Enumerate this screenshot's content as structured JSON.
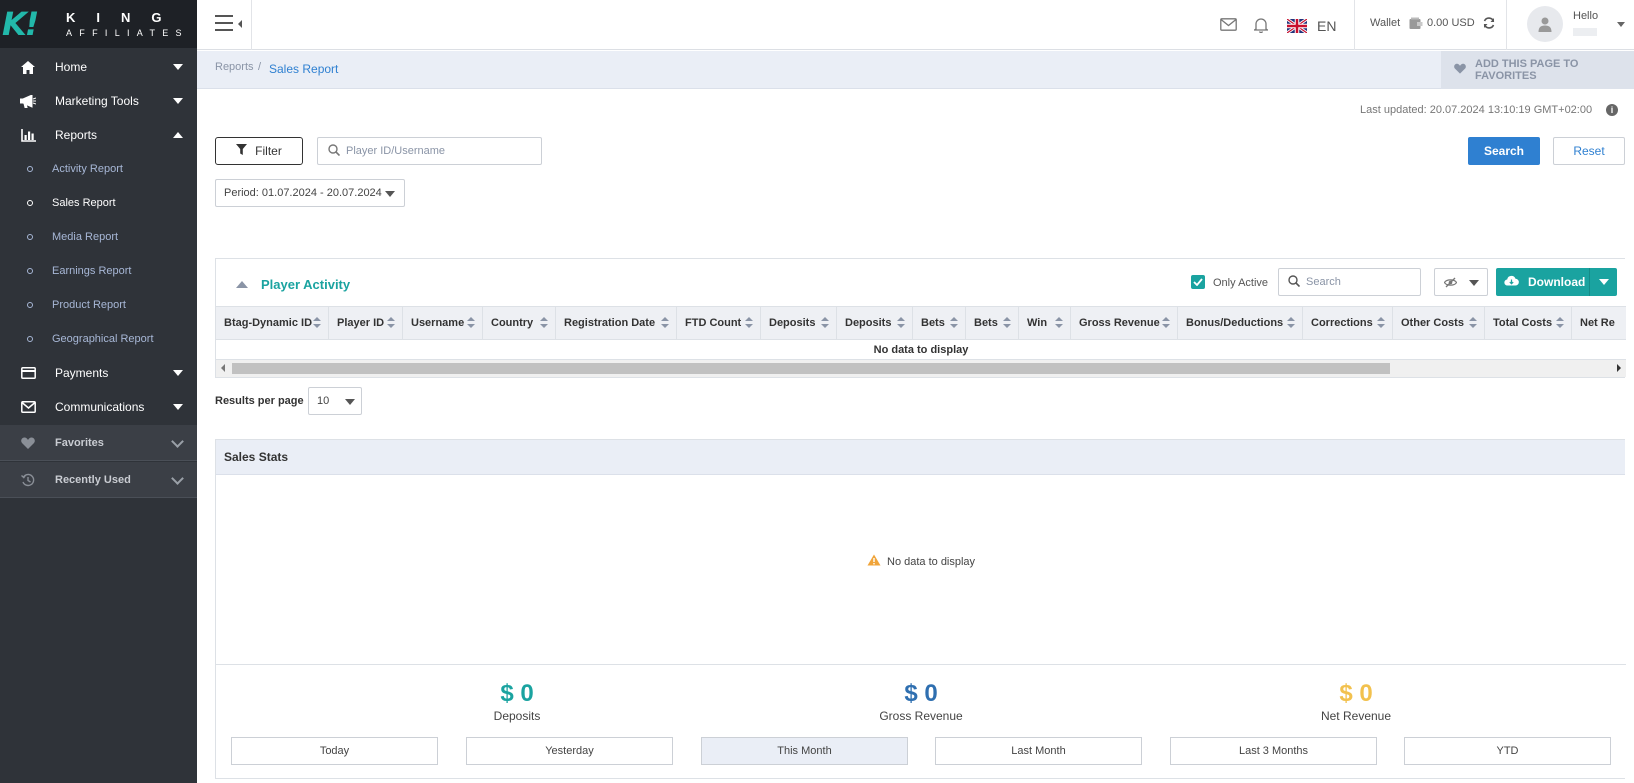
{
  "brand": {
    "logo_mark": "K!",
    "line1": "KING",
    "line2": "AFFILIATES"
  },
  "sidebar": {
    "items": [
      {
        "label": "Home",
        "icon": "home-icon"
      },
      {
        "label": "Marketing Tools",
        "icon": "megaphone-icon"
      },
      {
        "label": "Reports",
        "icon": "bar-chart-icon"
      },
      {
        "label": "Payments",
        "icon": "credit-card-icon"
      },
      {
        "label": "Communications",
        "icon": "envelope-icon"
      }
    ],
    "reports_sub": [
      "Activity Report",
      "Sales Report",
      "Media Report",
      "Earnings Report",
      "Product Report",
      "Geographical Report"
    ],
    "favorites_label": "Favorites",
    "recent_label": "Recently Used"
  },
  "topbar": {
    "language": "EN",
    "wallet_label": "Wallet",
    "wallet_value": "0.00 USD",
    "hello": "Hello"
  },
  "breadcrumb": {
    "parent": "Reports",
    "separator": "/",
    "current": "Sales Report"
  },
  "favorites_button": "ADD THIS PAGE TO FAVORITES",
  "last_updated": "Last updated: 20.07.2024 13:10:19 GMT+02:00",
  "filter": {
    "filter_label": "Filter",
    "search_placeholder": "Player ID/Username",
    "search_button": "Search",
    "reset_button": "Reset",
    "period": "Period: 01.07.2024 - 20.07.2024"
  },
  "player_activity": {
    "title": "Player Activity",
    "only_active_label": "Only Active",
    "search_placeholder": "Search",
    "download_label": "Download",
    "columns": [
      "Btag-Dynamic ID",
      "Player ID",
      "Username",
      "Country",
      "Registration Date",
      "FTD Count",
      "Deposits",
      "Deposits",
      "Bets",
      "Bets",
      "Win",
      "Gross Revenue",
      "Bonus/Deductions",
      "Corrections",
      "Other Costs",
      "Total Costs",
      "Net Re"
    ],
    "empty_text": "No data to display"
  },
  "results_per_page": {
    "label": "Results per page",
    "value": "10"
  },
  "sales_stats": {
    "title": "Sales Stats",
    "empty_text": "No data to display",
    "metrics": [
      {
        "value": "$ 0",
        "label": "Deposits",
        "color": "#1aa3a0"
      },
      {
        "value": "$ 0",
        "label": "Gross Revenue",
        "color": "#2f6fb0"
      },
      {
        "value": "$ 0",
        "label": "Net Revenue",
        "color": "#f2c14e"
      }
    ],
    "periods": [
      "Today",
      "Yesterday",
      "This Month",
      "Last Month",
      "Last 3 Months",
      "YTD"
    ],
    "active_period": "This Month"
  },
  "colors": {
    "sidebar_bg": "#2f3339",
    "accent_teal": "#1aa3a0",
    "primary_blue": "#2f80d1"
  }
}
